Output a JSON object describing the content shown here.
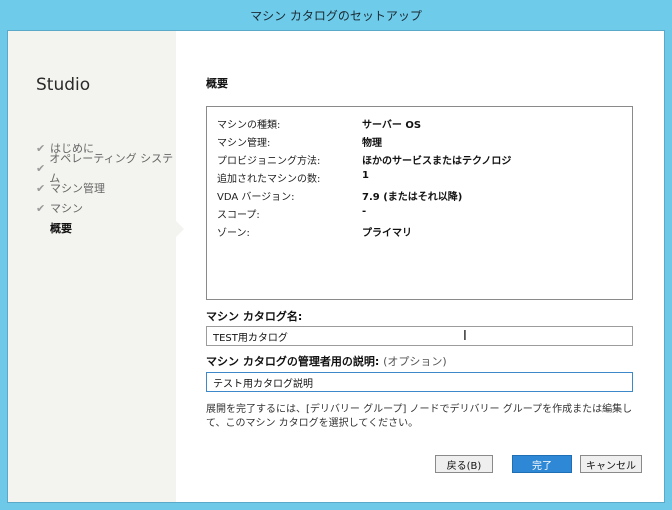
{
  "window": {
    "title": "マシン カタログのセットアップ"
  },
  "sidebar": {
    "brand": "Studio",
    "steps": [
      {
        "label": "はじめに",
        "done": true
      },
      {
        "label": "オペレーティング システム",
        "done": true
      },
      {
        "label": "マシン管理",
        "done": true
      },
      {
        "label": "マシン",
        "done": true
      },
      {
        "label": "概要",
        "current": true
      }
    ]
  },
  "summary": {
    "title": "概要",
    "rows": [
      {
        "key": "マシンの種類:",
        "value": "サーバー OS"
      },
      {
        "key": "マシン管理:",
        "value": "物理"
      },
      {
        "key": "プロビジョニング方法:",
        "value": "ほかのサービスまたはテクノロジ"
      },
      {
        "key": "追加されたマシンの数:",
        "value": "1"
      },
      {
        "key": "VDA バージョン:",
        "value": "7.9 (またはそれ以降)"
      },
      {
        "key": "スコープ:",
        "value": "-"
      },
      {
        "key": "ゾーン:",
        "value": "プライマリ"
      }
    ]
  },
  "form": {
    "catalog_name_label": "マシン カタログ名:",
    "catalog_name_value": "TEST用カタログ",
    "description_label": "マシン カタログの管理者用の説明:",
    "description_optional": "(オプション)",
    "description_value": "テスト用カタログ説明",
    "note": "展開を完了するには、[デリバリー グループ] ノードでデリバリー グループを作成または編集して、このマシン カタログを選択してください。"
  },
  "buttons": {
    "back": "戻る(B)",
    "finish": "完了",
    "cancel": "キャンセル"
  },
  "colors": {
    "titlebar": "#6fcbea",
    "primary_button": "#2f88d6",
    "sidebar_bg": "#f3f3ef"
  }
}
